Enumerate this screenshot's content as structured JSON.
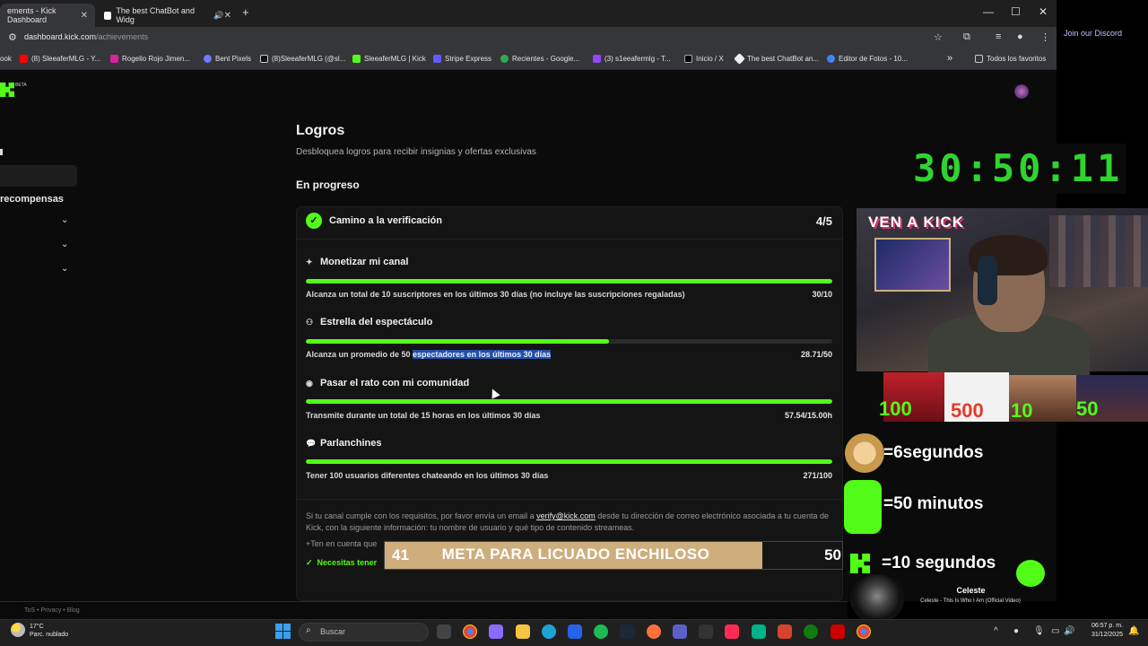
{
  "browser": {
    "tabs": [
      {
        "label": "ements - Kick Dashboard",
        "close": "✕"
      },
      {
        "label": "The best ChatBot and Widg",
        "close": "✕"
      }
    ],
    "new_tab": "+",
    "window": {
      "minimize": "—",
      "maximize": "☐",
      "close": "✕"
    },
    "address": {
      "domain": "dashboard.kick.com",
      "path": "/achievements"
    },
    "bookmarks": [
      "ook",
      "(8) SleeaferMLG - Y...",
      "Rogelio Rojo Jimen...",
      "Bent Pixels",
      "(8)SleeaferMLG (@sl...",
      "SleeaferMLG | Kick",
      "Stripe Express",
      "Recientes - Google...",
      "(3) s1eeafermlg - T...",
      "Inicio / X",
      "The best ChatBot an...",
      "Editor de Fotos - 10..."
    ],
    "bookmarks_more": "»",
    "all_favorites": "Todos los favoritos"
  },
  "sidebar": {
    "rewards_label": "recompensas",
    "chevron": "⌄"
  },
  "page": {
    "title": "Logros",
    "subtitle": "Desbloquea logros para recibir insignias y ofertas exclusivas",
    "in_progress": "En progreso",
    "card": {
      "title": "Camino a la verificación",
      "count": "4/5",
      "achievements": [
        {
          "name": "Monetizar mi canal",
          "icon": "✦",
          "progress": 1.0,
          "desc": "Alcanza un total de 10 suscriptores en los últimos 30 días (no incluye las suscripciones regaladas)",
          "value": "30/10"
        },
        {
          "name": "Estrella del espectáculo",
          "icon": "⚇",
          "progress": 0.575,
          "desc_a": "Alcanza un promedio de 50 ",
          "desc_hl": "espectadores en los últimos 30 días",
          "value": "28.71/50"
        },
        {
          "name": "Pasar el rato con mi comunidad",
          "icon": "◉",
          "progress": 1.0,
          "desc": "Transmite durante un total de 15 horas en los últimos 30 días",
          "value": "57.54/15.00h"
        },
        {
          "name": "Parlanchines",
          "icon": "💬",
          "progress": 1.0,
          "desc": "Tener 100 usuarios diferentes chateando en los últimos 30 días",
          "value": "271/100"
        }
      ],
      "footer_a": "Si tu canal cumple con los requisitos, por favor envía un email a ",
      "footer_link": "verify@kick.com",
      "footer_b": " desde tu dirección de correo electrónico asociada a tu cuenta de Kick, con la siguiente información: tu nombre de usuario y qué tipo de contenido streameas.",
      "footer_note": "+Ten en cuenta que",
      "need": "Necesitas tener"
    }
  },
  "overlay": {
    "timer": "30:50:11",
    "cam_text": "VEN A KICK",
    "donations": [
      "100",
      "500",
      "10",
      "50"
    ],
    "rates": [
      {
        "text": "=6segundos",
        "icon": "tiktok-coin-icon"
      },
      {
        "text": "=50 minutos",
        "icon": "kick-sub-icon"
      },
      {
        "text": "=10 segundos",
        "icon": "kick-icon"
      }
    ],
    "goal": {
      "current": "41",
      "title": "META PARA LICUADO ENCHILOSO",
      "target": "50",
      "progress": 0.82
    },
    "now_playing": {
      "artist": "Celeste",
      "song": "Celeste - This Is Who I Am (Official Video)"
    },
    "discord": "Join our Discord"
  },
  "status_strip": "ToS • Privacy • Blog",
  "taskbar": {
    "weather_temp": "17°C",
    "weather_desc": "Parc. nublado",
    "search_placeholder": "Buscar",
    "time": "06:57 p. m.",
    "date": "31/12/2025"
  },
  "colors": {
    "accent": "#53fc18",
    "highlight": "#2350a8",
    "goal_fill": "#cfae7e",
    "timer": "#2fd42f"
  }
}
